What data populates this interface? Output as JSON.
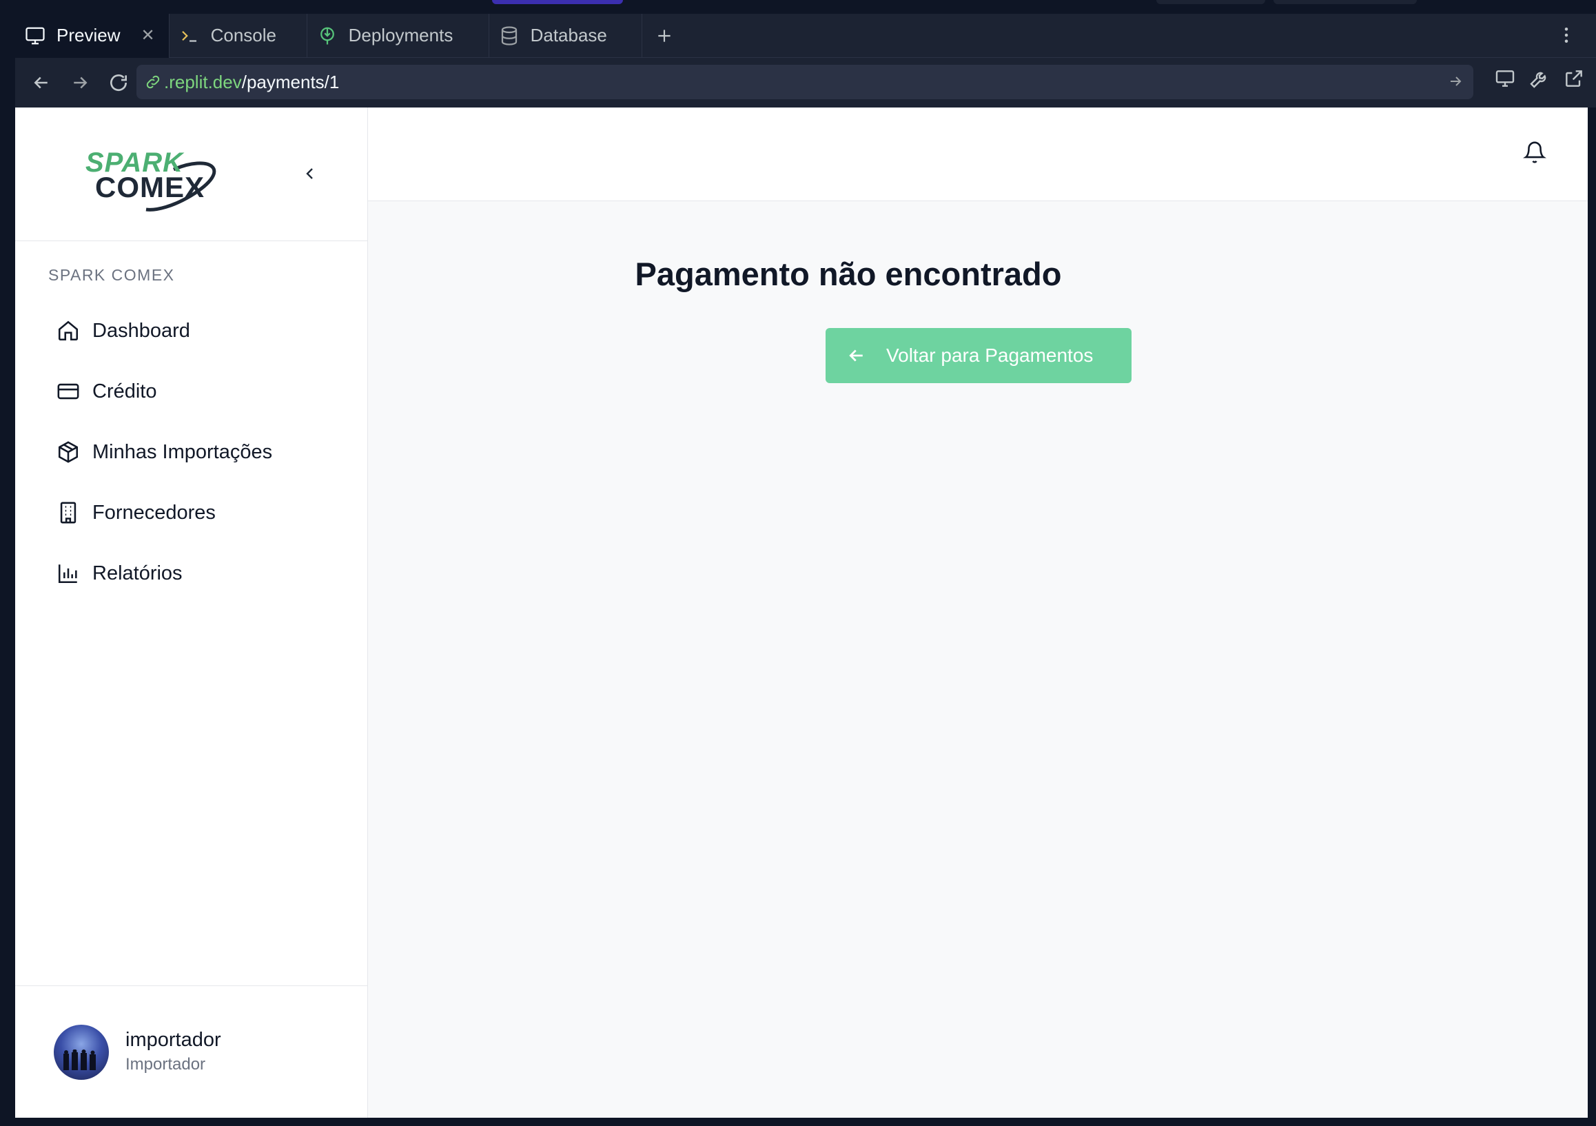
{
  "browser": {
    "tabs": [
      {
        "label": "Preview",
        "icon": "monitor-icon",
        "active": true
      },
      {
        "label": "Console",
        "icon": "terminal-icon"
      },
      {
        "label": "Deployments",
        "icon": "deployments-icon"
      },
      {
        "label": "Database",
        "icon": "database-icon"
      }
    ],
    "url_host": ".replit.dev",
    "url_path": "/payments/1"
  },
  "sidebar": {
    "brand_top": "SPARK",
    "brand_bottom": "COMEX",
    "section_label": "SPARK COMEX",
    "items": [
      {
        "label": "Dashboard",
        "icon": "home-icon"
      },
      {
        "label": "Crédito",
        "icon": "credit-card-icon"
      },
      {
        "label": "Minhas Importações",
        "icon": "package-icon"
      },
      {
        "label": "Fornecedores",
        "icon": "building-icon"
      },
      {
        "label": "Relatórios",
        "icon": "bar-chart-icon"
      }
    ],
    "user": {
      "name": "importador",
      "role": "Importador"
    }
  },
  "main": {
    "title": "Pagamento não encontrado",
    "back_label": "Voltar para Pagamentos"
  },
  "colors": {
    "accent": "#6ed3a0",
    "brand_green": "#4caf72",
    "chrome_bg": "#1c2333",
    "url_host": "#7ed67e"
  }
}
